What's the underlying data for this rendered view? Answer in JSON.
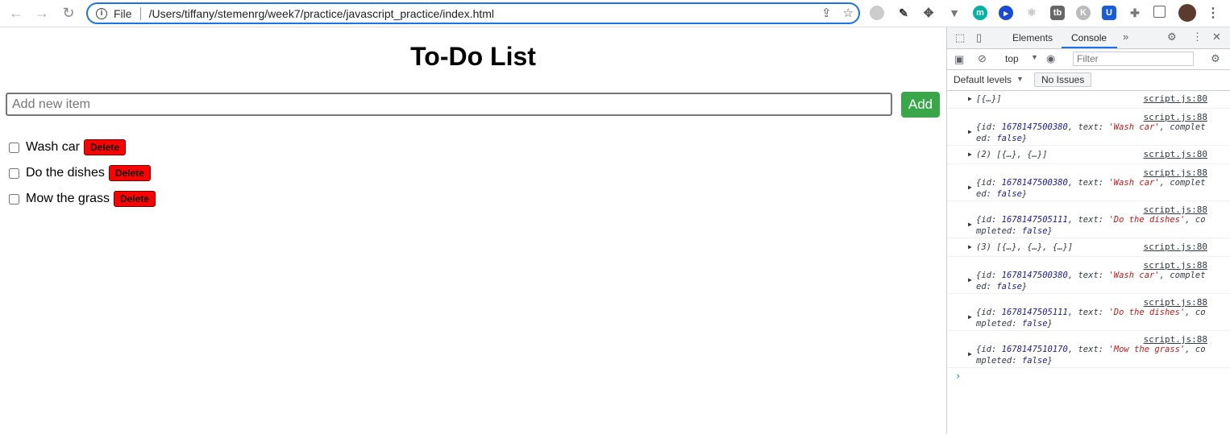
{
  "browser": {
    "url_scheme": "File",
    "url": "/Users/tiffany/stemenrg/week7/practice/javascript_practice/index.html"
  },
  "page": {
    "title": "To-Do List",
    "input_placeholder": "Add new item",
    "add_label": "Add",
    "items": [
      {
        "text": "Wash car",
        "checked": false,
        "delete_label": "Delete"
      },
      {
        "text": "Do the dishes",
        "checked": false,
        "delete_label": "Delete"
      },
      {
        "text": "Mow the grass",
        "checked": false,
        "delete_label": "Delete"
      }
    ]
  },
  "devtools": {
    "tabs": [
      "Elements",
      "Console"
    ],
    "active_tab": "Console",
    "context": "top",
    "filter_placeholder": "Filter",
    "levels_label": "Default levels",
    "issues_label": "No Issues",
    "logs": [
      {
        "src": "script.js:80",
        "text": "[{…}]"
      },
      {
        "src": "script.js:88",
        "id": "1678147500380",
        "todo": "'Wash car'",
        "completed": "false"
      },
      {
        "src": "script.js:80",
        "text": "(2) [{…}, {…}]"
      },
      {
        "src": "script.js:88",
        "id": "1678147500380",
        "todo": "'Wash car'",
        "completed": "false"
      },
      {
        "src": "script.js:88",
        "id": "1678147505111",
        "todo": "'Do the dishes'",
        "completed": "false"
      },
      {
        "src": "script.js:80",
        "text": "(3) [{…}, {…}, {…}]"
      },
      {
        "src": "script.js:88",
        "id": "1678147500380",
        "todo": "'Wash car'",
        "completed": "false"
      },
      {
        "src": "script.js:88",
        "id": "1678147505111",
        "todo": "'Do the dishes'",
        "completed": "false"
      },
      {
        "src": "script.js:88",
        "id": "1678147510170",
        "todo": "'Mow the grass'",
        "completed": "false"
      }
    ],
    "prompt": "›"
  }
}
